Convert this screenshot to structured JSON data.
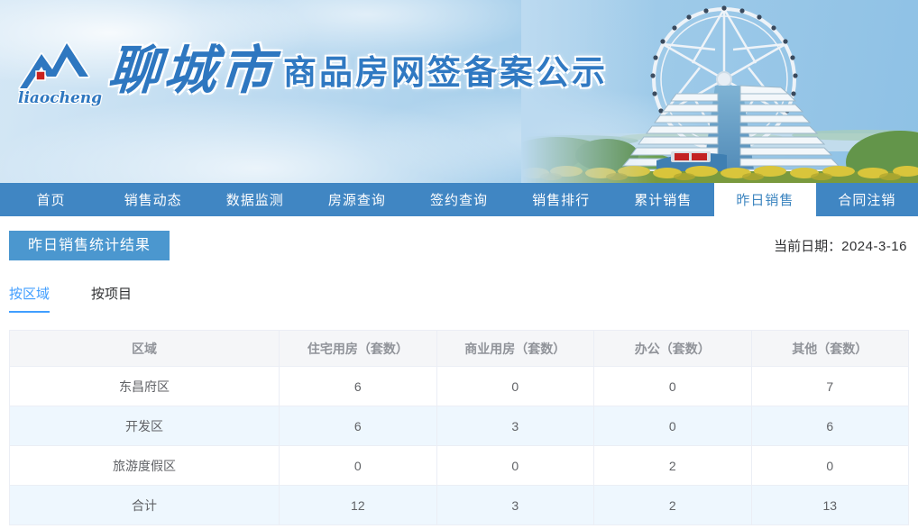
{
  "header": {
    "logo_script": "liaocheng",
    "logo_city": "聊城市",
    "site_title": "商品房网签备案公示"
  },
  "nav": {
    "items": [
      {
        "label": "首页"
      },
      {
        "label": "销售动态"
      },
      {
        "label": "数据监测"
      },
      {
        "label": "房源查询"
      },
      {
        "label": "签约查询"
      },
      {
        "label": "销售排行"
      },
      {
        "label": "累计销售"
      },
      {
        "label": "昨日销售",
        "active": true
      },
      {
        "label": "合同注销"
      }
    ]
  },
  "page": {
    "section_title": "昨日销售统计结果",
    "date_label": "当前日期：",
    "date_value": "2024-3-16"
  },
  "tabs": [
    {
      "label": "按区域",
      "active": true
    },
    {
      "label": "按项目",
      "active": false
    }
  ],
  "table": {
    "columns": [
      "区域",
      "住宅用房（套数）",
      "商业用房（套数）",
      "办公（套数）",
      "其他（套数）"
    ],
    "rows": [
      [
        "东昌府区",
        "6",
        "0",
        "0",
        "7"
      ],
      [
        "开发区",
        "6",
        "3",
        "0",
        "6"
      ],
      [
        "旅游度假区",
        "0",
        "0",
        "2",
        "0"
      ],
      [
        "合计",
        "12",
        "3",
        "2",
        "13"
      ]
    ]
  },
  "colors": {
    "nav_blue": "#4086c3",
    "badge_blue": "#4b97cf",
    "tab_active_blue": "#409eff",
    "title_blue": "#3079c2",
    "stripe_row": "#eef7fe",
    "table_border": "#ebeef5",
    "header_text": "#909399",
    "cell_text": "#606266",
    "logo_red": "#c9211e"
  }
}
